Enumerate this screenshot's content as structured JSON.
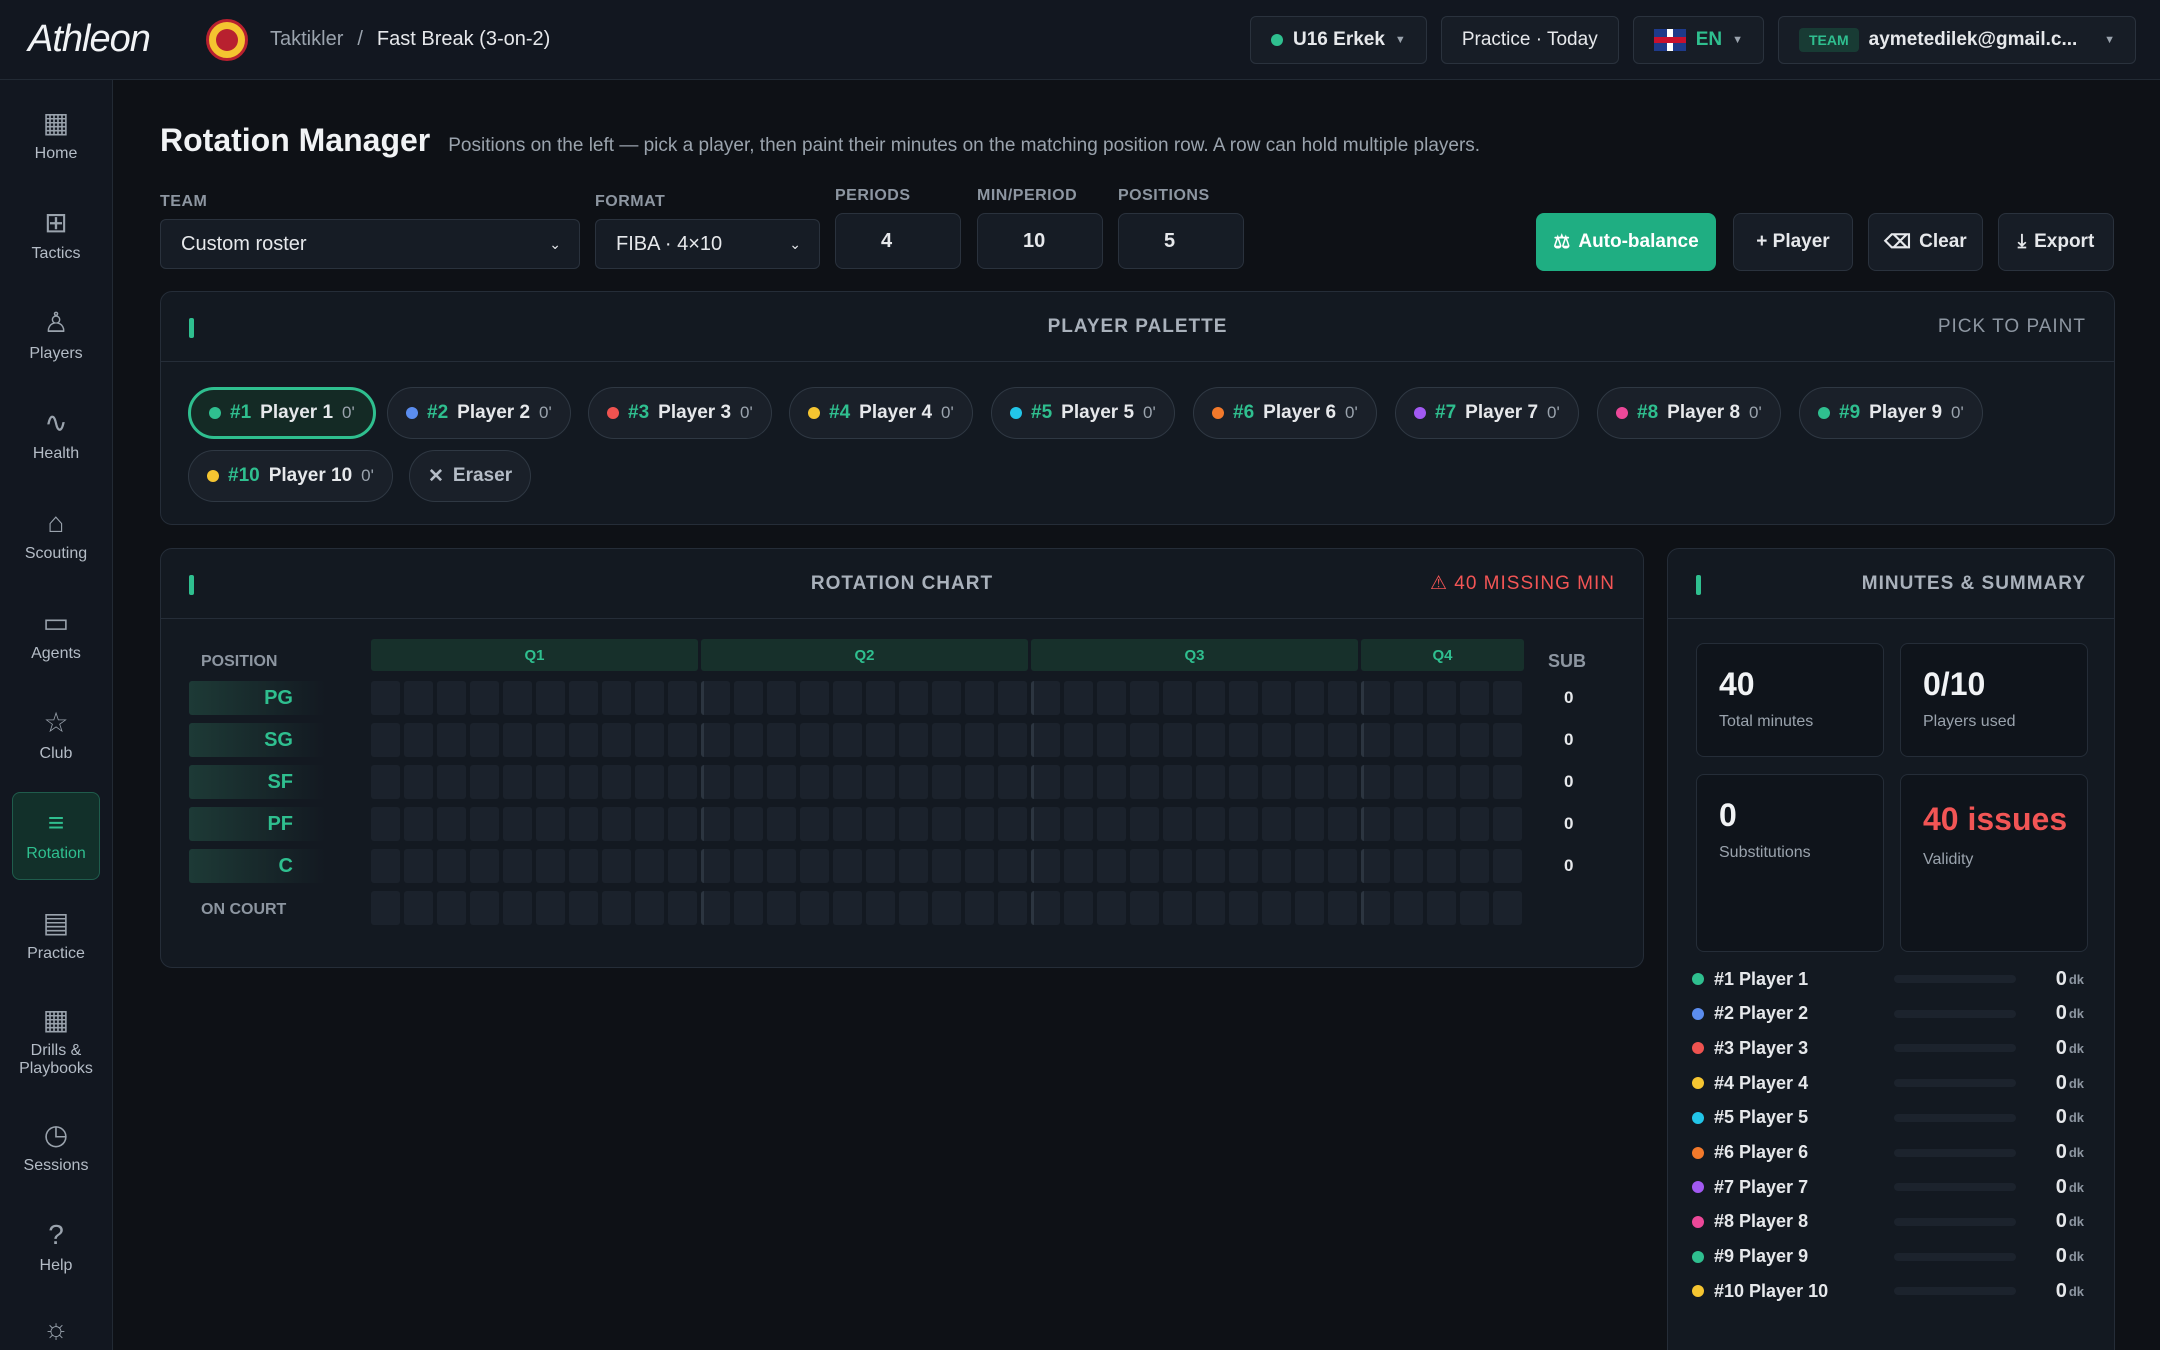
{
  "app": {
    "logo": "Athleon"
  },
  "breadcrumb": {
    "section": "Taktikler",
    "separator": "/",
    "current": "Fast Break (3-on-2)"
  },
  "topbar": {
    "team_selector": "U16 Erkek",
    "practice": "Practice · Today",
    "language": "EN",
    "account_tag": "TEAM",
    "account": "aymetedilek@gmail.c..."
  },
  "sidebar": {
    "items": [
      {
        "label": "Home",
        "icon": "grid-icon"
      },
      {
        "label": "Tactics",
        "icon": "tactics-icon"
      },
      {
        "label": "Players",
        "icon": "users-icon"
      },
      {
        "label": "Health",
        "icon": "pulse-icon"
      },
      {
        "label": "Scouting",
        "icon": "building-icon"
      },
      {
        "label": "Agents",
        "icon": "robot-icon"
      },
      {
        "label": "Club",
        "icon": "star-icon"
      },
      {
        "label": "Rotation",
        "icon": "sliders-icon",
        "active": true
      },
      {
        "label": "Practice",
        "icon": "document-icon"
      },
      {
        "label": "Drills & Playbooks",
        "icon": "layout-icon"
      },
      {
        "label": "Sessions",
        "icon": "clock-icon"
      },
      {
        "label": "Help",
        "icon": "help-icon"
      },
      {
        "label": "",
        "icon": "settings-icon"
      }
    ]
  },
  "page": {
    "title": "Rotation Manager",
    "subtitle": "Positions on the left — pick a player, then paint their minutes on the matching position row. A row can hold multiple players."
  },
  "controls": {
    "team_label": "TEAM",
    "team_value": "Custom roster",
    "format_label": "FORMAT",
    "format_value": "FIBA · 4×10",
    "periods_label": "PERIODS",
    "periods_value": "4",
    "min_period_label": "MIN/PERIOD",
    "min_period_value": "10",
    "positions_label": "POSITIONS",
    "positions_value": "5",
    "auto_balance": "Auto-balance",
    "add_player": "+ Player",
    "clear": "Clear",
    "export": "Export"
  },
  "palette": {
    "title": "PLAYER PALETTE",
    "hint": "PICK TO PAINT",
    "players": [
      {
        "no": "#1",
        "name": "Player 1",
        "min": "0'",
        "color": "#2fbf8f",
        "selected": true
      },
      {
        "no": "#2",
        "name": "Player 2",
        "min": "0'",
        "color": "#5b8def"
      },
      {
        "no": "#3",
        "name": "Player 3",
        "min": "0'",
        "color": "#ef5350"
      },
      {
        "no": "#4",
        "name": "Player 4",
        "min": "0'",
        "color": "#f5c531"
      },
      {
        "no": "#5",
        "name": "Player 5",
        "min": "0'",
        "color": "#22c5e8"
      },
      {
        "no": "#6",
        "name": "Player 6",
        "min": "0'",
        "color": "#f2792b"
      },
      {
        "no": "#7",
        "name": "Player 7",
        "min": "0'",
        "color": "#a259f2"
      },
      {
        "no": "#8",
        "name": "Player 8",
        "min": "0'",
        "color": "#ec4899"
      },
      {
        "no": "#9",
        "name": "Player 9",
        "min": "0'",
        "color": "#2fbf8f"
      },
      {
        "no": "#10",
        "name": "Player 10",
        "min": "0'",
        "color": "#f5c531"
      }
    ],
    "eraser": "Eraser"
  },
  "rotation": {
    "title": "ROTATION CHART",
    "missing": "40 MISSING MIN",
    "position_header": "POSITION",
    "sub_header": "SUB",
    "quarters": [
      "Q1",
      "Q2",
      "Q3",
      "Q4"
    ],
    "positions": [
      "PG",
      "SG",
      "SF",
      "PF",
      "C"
    ],
    "subs": [
      "0",
      "0",
      "0",
      "0",
      "0"
    ],
    "on_court": "ON COURT"
  },
  "summary": {
    "title": "MINUTES & SUMMARY",
    "total_minutes": "40",
    "total_minutes_label": "Total minutes",
    "players_used": "0/10",
    "players_used_label": "Players used",
    "substitutions": "0",
    "substitutions_label": "Substitutions",
    "validity": "40 issues",
    "validity_label": "Validity",
    "unit": "dk",
    "players": [
      {
        "label": "#1 Player 1",
        "min": "0",
        "color": "#2fbf8f"
      },
      {
        "label": "#2 Player 2",
        "min": "0",
        "color": "#5b8def"
      },
      {
        "label": "#3 Player 3",
        "min": "0",
        "color": "#ef5350"
      },
      {
        "label": "#4 Player 4",
        "min": "0",
        "color": "#f5c531"
      },
      {
        "label": "#5 Player 5",
        "min": "0",
        "color": "#22c5e8"
      },
      {
        "label": "#6 Player 6",
        "min": "0",
        "color": "#f2792b"
      },
      {
        "label": "#7 Player 7",
        "min": "0",
        "color": "#a259f2"
      },
      {
        "label": "#8 Player 8",
        "min": "0",
        "color": "#ec4899"
      },
      {
        "label": "#9 Player 9",
        "min": "0",
        "color": "#2fbf8f"
      },
      {
        "label": "#10 Player 10",
        "min": "0",
        "color": "#f5c531"
      }
    ]
  }
}
